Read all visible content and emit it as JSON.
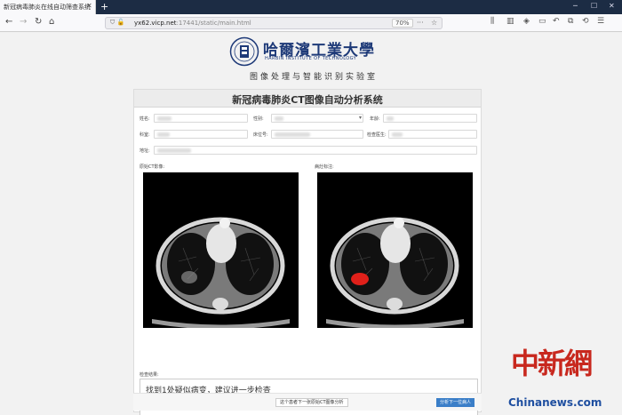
{
  "browser": {
    "tab_title": "新冠病毒肺炎在线自动筛查系统",
    "url_host": "yx62.vicp.net",
    "url_path": ":17441/static/main.html",
    "zoom": "70%"
  },
  "header": {
    "logo_cn": "哈爾濱工業大學",
    "logo_en": "HARBIN INSTITUTE OF TECHNOLOGY",
    "lab_name": "图像处理与智能识别实验室"
  },
  "app": {
    "title": "新冠病毒肺炎CT图像自动分析系统",
    "fields": {
      "name_label": "姓名:",
      "gender_label": "性别:",
      "age_label": "年龄:",
      "hospital_label": "科室:",
      "bed_label": "床位号:",
      "doctor_label": "检查医生:",
      "address_label": "地址:"
    },
    "images": {
      "original_label": "原始CT影像:",
      "result_label": "病灶标注:"
    },
    "result": {
      "label": "检查结果:",
      "text": "找到1处疑似病变，建议进一步检查"
    },
    "buttons": {
      "next_image": "这个患者下一张原始CT图像分析",
      "next_patient": "分析下一位病人"
    }
  },
  "watermark": {
    "cn": "中新網",
    "en": "Chinanews.com"
  },
  "colors": {
    "brand_blue": "#1e3a78",
    "lesion_red": "#e0201a",
    "primary_button": "#3a7ec8",
    "watermark_red": "#c8281e"
  }
}
